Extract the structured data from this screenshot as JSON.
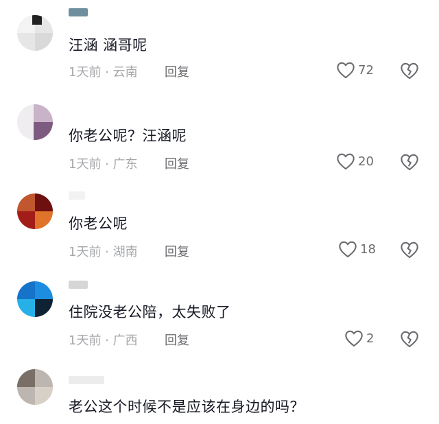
{
  "comments": [
    {
      "text": "汪涵 涵哥呢",
      "time": "1天前",
      "location": "云南",
      "reply": "回复",
      "likes": "72"
    },
    {
      "text": "你老公呢？汪涵呢",
      "time": "1天前",
      "location": "广东",
      "reply": "回复",
      "likes": "20"
    },
    {
      "text": "你老公呢",
      "time": "1天前",
      "location": "湖南",
      "reply": "回复",
      "likes": "18"
    },
    {
      "text": "住院没老公陪，太失败了",
      "time": "1天前",
      "location": "广西",
      "reply": "回复",
      "likes": "2"
    },
    {
      "text": "老公这个时候不是应该在身边的吗？"
    }
  ],
  "separator": " · ",
  "icons": {
    "like": "heart-outline-icon",
    "dislike": "broken-heart-icon"
  },
  "colors": {
    "text": "#161823",
    "meta": "#a6a7ab",
    "secondary": "#6b6c70"
  }
}
